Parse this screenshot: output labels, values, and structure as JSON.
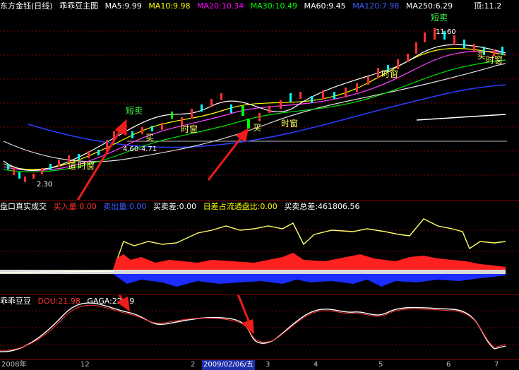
{
  "main_panel": {
    "title": "东方金钰(日线)",
    "indicator": "乖乖豆主图",
    "ma": [
      {
        "label": "MA5:9.99",
        "color": "#ffffff"
      },
      {
        "label": "MA10:9.98",
        "color": "#ffff00"
      },
      {
        "label": "MA20:10.34",
        "color": "#ff00ff"
      },
      {
        "label": "MA30:10.49",
        "color": "#00ff00"
      },
      {
        "label": "MA60:9.45",
        "color": "#ffffff"
      },
      {
        "label": "MA120:7.98",
        "color": "#3b5bff"
      },
      {
        "label": "MA250:6.29",
        "color": "#ffffff"
      }
    ],
    "top_label": "顶:11.2",
    "annotations": {
      "short_sell_left": "短卖",
      "short_sell_right": "短卖",
      "low_price": "2.30",
      "mid_price": "4.60-4.71",
      "high_price": "11.60",
      "buy_1": "买",
      "buy_2": "买",
      "buy_3": "买",
      "time_window": "时窗",
      "reduce_label": "道"
    }
  },
  "volume_panel": {
    "title": "盘口真实成交",
    "fields": [
      {
        "label": "买入量:0.00",
        "color": "#ff3030"
      },
      {
        "label": "卖出量:0.00",
        "color": "#3b5bff"
      },
      {
        "label": "买卖差:0.00",
        "color": "#ffffff"
      },
      {
        "label": "日差占流通盘比:0.00",
        "color": "#ffff00"
      },
      {
        "label": "买卖总差:461806.56",
        "color": "#ffffff"
      }
    ]
  },
  "osc_panel": {
    "title": "乖乖豆豆",
    "fields": [
      {
        "label": "DOU:21.98",
        "color": "#ff3030"
      },
      {
        "label": "GAGA:22.19",
        "color": "#ffffff"
      }
    ]
  },
  "date_axis": {
    "labels": [
      "2008年",
      "12",
      "2",
      "2009/02/06/五",
      "3",
      "4",
      "5",
      "6",
      "7"
    ],
    "selected": "2009/02/06/五"
  }
}
